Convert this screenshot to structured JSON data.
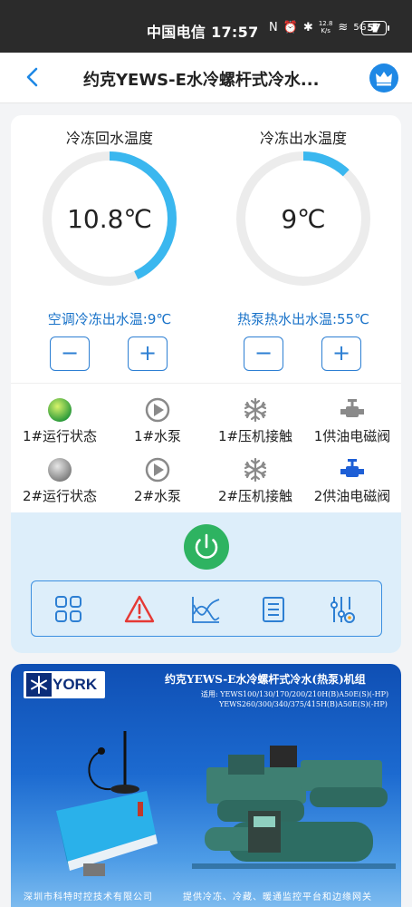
{
  "status_bar": {
    "carrier_time": "中国电信 17:57",
    "net_speed_top": "12.8",
    "net_speed_bottom": "K/s",
    "signal": "5G",
    "battery": "57"
  },
  "header": {
    "title": "约克YEWS-E水冷螺杆式冷水..."
  },
  "gauges": [
    {
      "label": "冷冻回水温度",
      "value": "10.8℃",
      "fill": 0.43
    },
    {
      "label": "冷冻出水温度",
      "value": "9℃",
      "fill": 0.12
    }
  ],
  "setpoints": [
    {
      "label": "空调冷冻出水温:9℃",
      "minus": "−",
      "plus": "+"
    },
    {
      "label": "热泵热水出水温:55℃",
      "minus": "−",
      "plus": "+"
    }
  ],
  "status_items": [
    {
      "label": "1#运行状态",
      "icon": "status-dot-icon",
      "state": "running"
    },
    {
      "label": "1#水泵",
      "icon": "pump-icon",
      "state": "off"
    },
    {
      "label": "1#压机接触",
      "icon": "snowflake-icon",
      "state": "off"
    },
    {
      "label": "1供油电磁阀",
      "icon": "valve-icon",
      "state": "off"
    },
    {
      "label": "2#运行状态",
      "icon": "status-dot-icon",
      "state": "stopped"
    },
    {
      "label": "2#水泵",
      "icon": "pump-icon",
      "state": "off"
    },
    {
      "label": "2#压机接触",
      "icon": "snowflake-icon",
      "state": "off"
    },
    {
      "label": "2供油电磁阀",
      "icon": "valve-icon",
      "state": "on"
    }
  ],
  "toolbar": {
    "icons": [
      "grid-icon",
      "alarm-icon",
      "chart-icon",
      "list-icon",
      "settings-sliders-icon"
    ]
  },
  "banner": {
    "brand": "YORK",
    "title": "约克YEWS-E水冷螺杆式冷水(热泵)机组",
    "models_line1": "适用: YEWS100/130/170/200/210H(B)A50E(S)(-HP)",
    "models_line2": "YEWS260/300/340/375/415H(B)A50E(S)(-HP)",
    "company": "深圳市科特时控技术有限公司",
    "slogan": "提供冷冻、冷藏、暖通监控平台和边缘网关"
  },
  "colors": {
    "accent": "#1a73c9",
    "gauge_fill": "#3ab7ef",
    "gauge_track": "#ececec",
    "running": "#4caf50",
    "power": "#2eb361",
    "alarm": "#e53935",
    "valve_on": "#1e5fd6"
  }
}
